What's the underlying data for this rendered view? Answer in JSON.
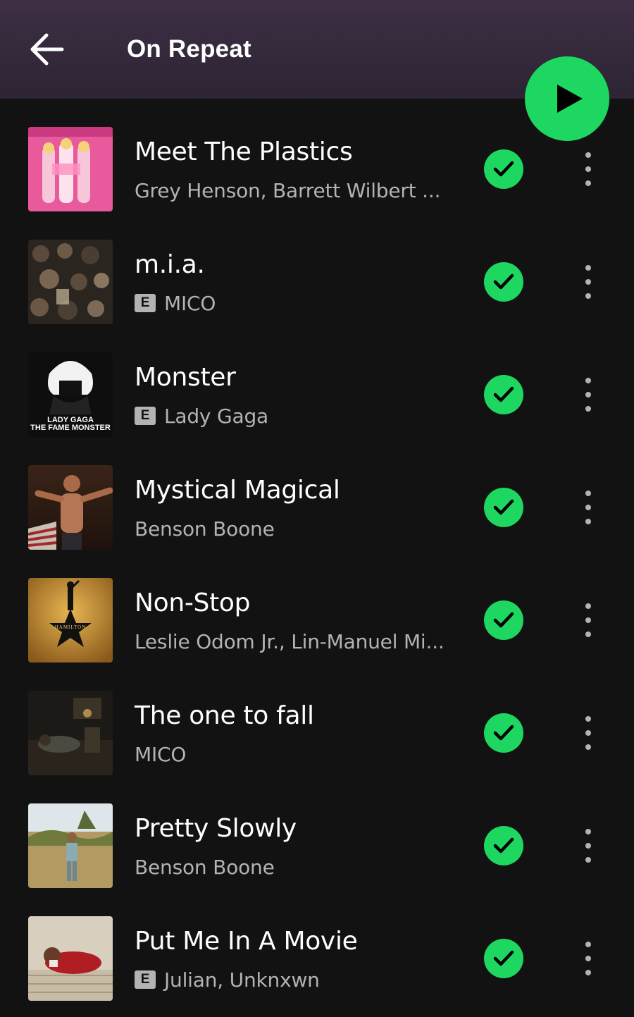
{
  "header": {
    "title": "On Repeat",
    "background": "#3a2d42"
  },
  "accent_color": "#1ed760",
  "tracks": [
    {
      "title": "Meet The Plastics",
      "artist": "Grey Henson, Barrett Wilbert ...",
      "explicit": false,
      "saved": true
    },
    {
      "title": "m.i.a.",
      "artist": "MICO",
      "explicit": true,
      "saved": true
    },
    {
      "title": "Monster",
      "artist": "Lady Gaga",
      "explicit": true,
      "saved": true,
      "art_text_1": "LADY GAGA",
      "art_text_2": "THE FAME MONSTER"
    },
    {
      "title": "Mystical Magical",
      "artist": "Benson Boone",
      "explicit": false,
      "saved": true
    },
    {
      "title": "Non-Stop",
      "artist": "Leslie Odom Jr., Lin-Manuel Mi...",
      "explicit": false,
      "saved": true,
      "art_text_1": "HAMILTON"
    },
    {
      "title": "The one to fall",
      "artist": "MICO",
      "explicit": false,
      "saved": true
    },
    {
      "title": "Pretty Slowly",
      "artist": "Benson Boone",
      "explicit": false,
      "saved": true
    },
    {
      "title": "Put Me In A Movie",
      "artist": "Julian, Unknxwn",
      "explicit": true,
      "saved": true
    }
  ],
  "explicit_label": "E",
  "icons": {
    "back": "arrow-left-icon",
    "play": "play-icon",
    "saved": "check-circle-icon",
    "more": "more-vertical-icon"
  }
}
